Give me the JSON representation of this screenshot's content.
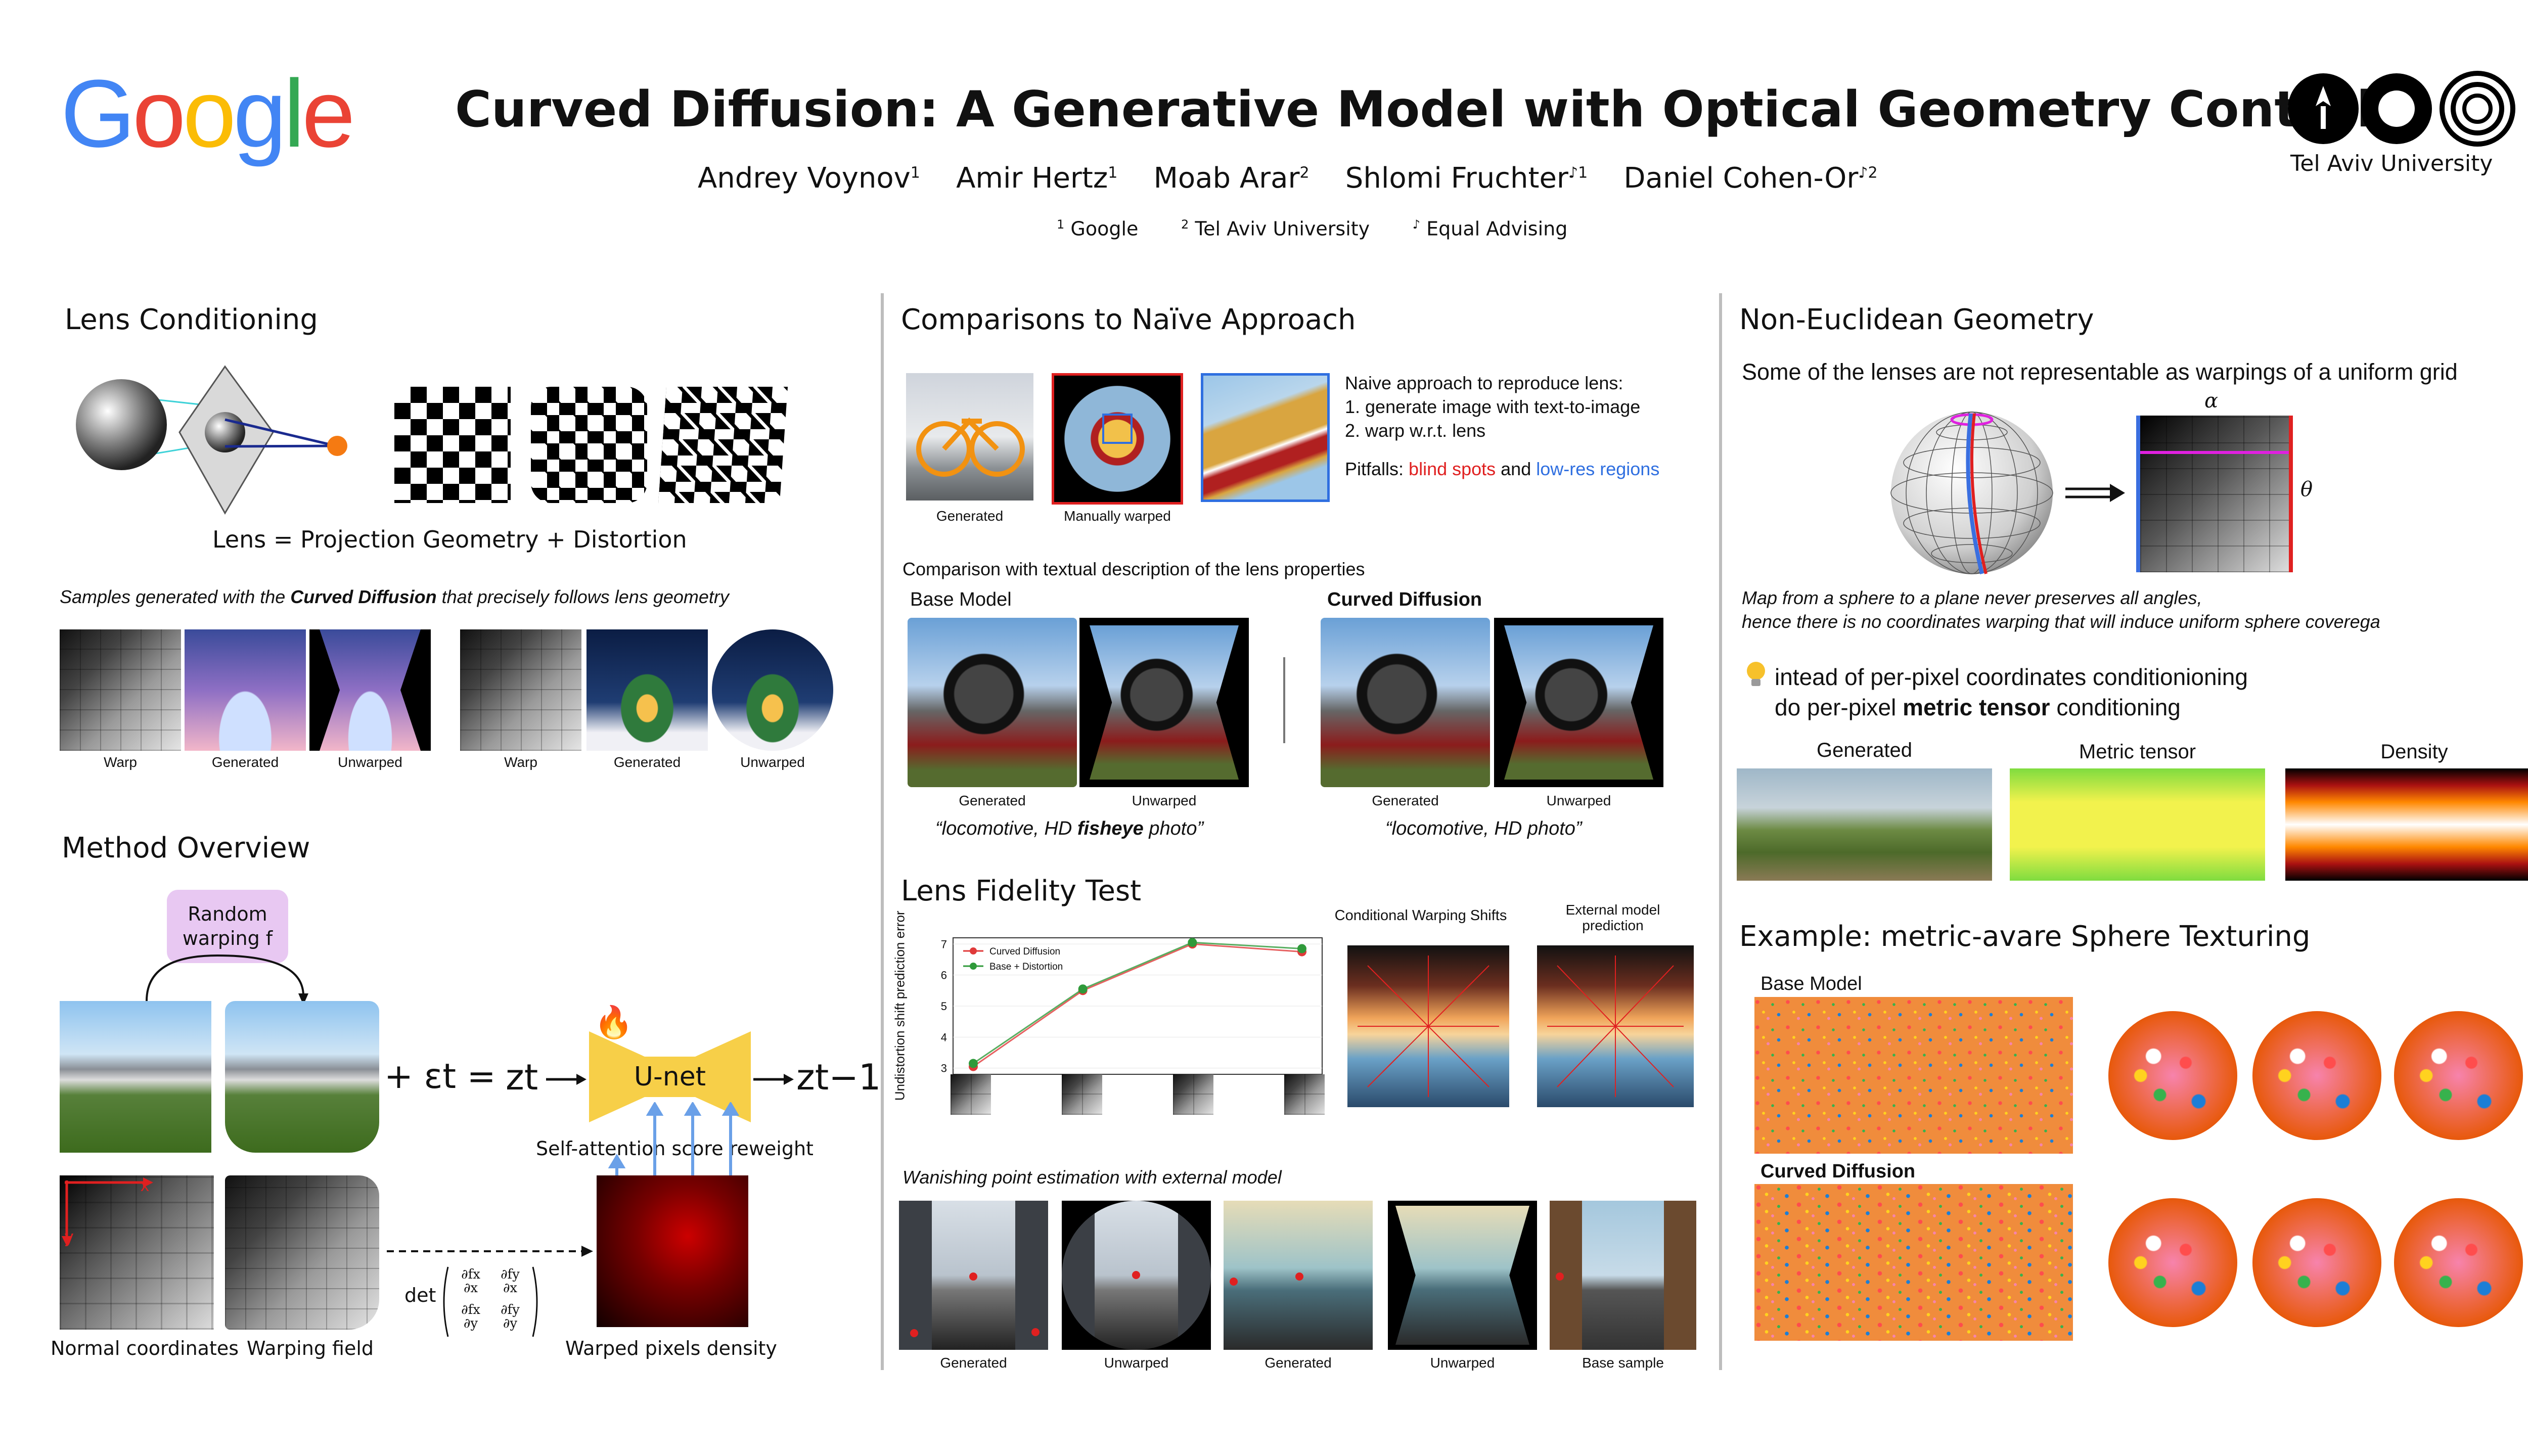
{
  "header": {
    "google_logo": "Google",
    "title": "Curved Diffusion: A Generative Model with Optical Geometry Control",
    "authors": [
      {
        "name": "Andrey Voynov",
        "sup": "1"
      },
      {
        "name": "Amir Hertz",
        "sup": "1"
      },
      {
        "name": "Moab Arar",
        "sup": "2"
      },
      {
        "name": "Shlomi Fruchter",
        "sup": "♪1"
      },
      {
        "name": "Daniel Cohen-Or",
        "sup": "♪2"
      }
    ],
    "affiliations": [
      {
        "sup": "1",
        "text": "Google"
      },
      {
        "sup": "2",
        "text": "Tel Aviv University"
      },
      {
        "sup": "♪",
        "text": "Equal Advising"
      }
    ],
    "tau_label": "Tel Aviv University"
  },
  "lens": {
    "title": "Lens Conditioning",
    "caption": "Lens = Projection Geometry + Distortion",
    "samples_prefix": "Samples generated with the ",
    "samples_bold": "Curved Diffusion",
    "samples_suffix": " that precisely follows lens geometry",
    "sample_labels": [
      "Warp",
      "Generated",
      "Unwarped",
      "Warp",
      "Generated",
      "Unwarped"
    ]
  },
  "method": {
    "title": "Method Overview",
    "random_warping": "Random warping f",
    "plus_eps": "+ εt =",
    "zt": "zt",
    "unet": "U-net",
    "zt1": "zt−1",
    "self_attn": "Self-attention score reweight",
    "det": "det",
    "jacobian": [
      "∂fx",
      "∂fy",
      "∂x",
      "∂x",
      "∂fx",
      "∂fy",
      "∂y",
      "∂y"
    ],
    "labels": [
      "Normal coordinates",
      "Warping field",
      "Warped pixels density"
    ],
    "axis_x": "x",
    "axis_y": "y"
  },
  "naive": {
    "title": "Comparisons to Naïve Approach",
    "img_labels": [
      "Generated",
      "Manually warped"
    ],
    "steps_intro": "Naive approach to reproduce lens:",
    "steps": [
      "1. generate image with text-to-image",
      "2. warp w.r.t. lens"
    ],
    "pitfalls_label": "Pitfalls: ",
    "pitfall_red": "blind spots",
    "pitfall_and": " and ",
    "pitfall_blue": "low-res regions",
    "textual_title": "Comparison with textual description of the lens properties",
    "base_model": "Base Model",
    "curved_diffusion": "Curved Diffusion",
    "pair_labels": [
      "Generated",
      "Unwarped",
      "Generated",
      "Unwarped"
    ],
    "prompt1_a": "“locomotive, HD ",
    "prompt1_b": "fisheye",
    "prompt1_c": " photo”",
    "prompt2": "“locomotive, HD photo”"
  },
  "fidelity": {
    "title": "Lens Fidelity Test",
    "cond_warp": "Conditional Warping Shifts",
    "ext_model": "External model prediction",
    "vanishing_title": "Wanishing point estimation with external model",
    "vanishing_labels": [
      "Generated",
      "Unwarped",
      "Generated",
      "Unwarped",
      "Base sample"
    ]
  },
  "chart_data": {
    "type": "line",
    "ylabel": "Undistortion shift prediction error",
    "x": [
      1,
      2,
      3,
      4
    ],
    "yticks": [
      3,
      4,
      5,
      6,
      7
    ],
    "ylim": [
      2.8,
      7.2
    ],
    "legend_position": "top-left",
    "series": [
      {
        "name": "Curved Diffusion",
        "color": "#e03a3a",
        "values": [
          3.05,
          5.5,
          7.0,
          6.75
        ]
      },
      {
        "name": "Base + Distortion",
        "color": "#2f9a3a",
        "values": [
          3.15,
          5.55,
          7.05,
          6.85
        ]
      }
    ]
  },
  "noneuclid": {
    "title": "Non-Euclidean Geometry",
    "subtitle": "Some of the lenses are not representable as warpings of a uniform grid",
    "alpha": "α",
    "theta": "θ",
    "map_line1": "Map from a sphere to a plane never preserves all angles,",
    "map_line2": "hence there is no coordinates warping that will induce uniform sphere coverega",
    "idea_line1": "intead of per-pixel coordinates conditionioning",
    "idea_line2_a": "do per-pixel ",
    "idea_line2_b": "metric tensor",
    "idea_line2_c": " conditioning",
    "panel_labels": [
      "Generated",
      "Metric tensor",
      "Density"
    ]
  },
  "texturing": {
    "title": "Example: metric-avare Sphere Texturing",
    "base_model": "Base Model",
    "curved_diffusion": "Curved Diffusion"
  }
}
